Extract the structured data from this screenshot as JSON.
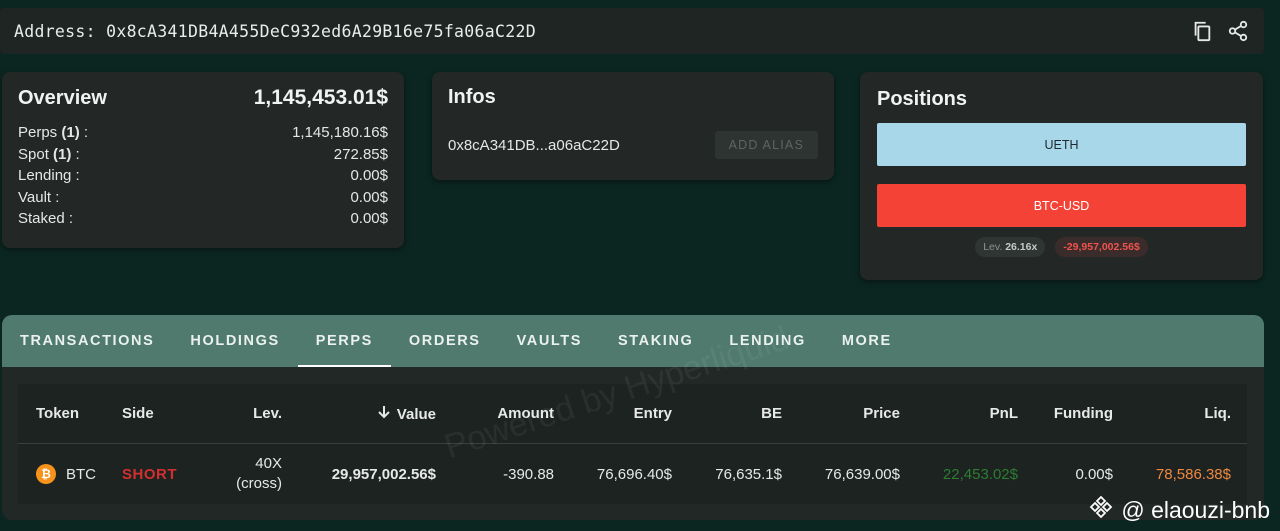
{
  "address_bar": {
    "label": "Address:",
    "address": "0x8cA341DB4A455DeC932ed6A29B16e75fa06aC22D",
    "icons": [
      "copy-icon",
      "share-icon"
    ]
  },
  "overview": {
    "title": "Overview",
    "total": "1,145,453.01$",
    "rows": [
      {
        "label": "Perps",
        "count": "(1)",
        "suffix": " :",
        "value": "1,145,180.16$"
      },
      {
        "label": "Spot",
        "count": "(1)",
        "suffix": " :",
        "value": "272.85$"
      },
      {
        "label": "Lending :",
        "count": "",
        "suffix": "",
        "value": "0.00$"
      },
      {
        "label": "Vault :",
        "count": "",
        "suffix": "",
        "value": "0.00$"
      },
      {
        "label": "Staked :",
        "count": "",
        "suffix": "",
        "value": "0.00$"
      }
    ]
  },
  "infos": {
    "title": "Infos",
    "short_address": "0x8cA341DB...a06aC22D",
    "alias_button": "ADD ALIAS"
  },
  "positions": {
    "title": "Positions",
    "items": [
      "UETH",
      "BTC-USD"
    ],
    "lev_label": "Lev.",
    "lev_value": "26.16x",
    "pnl": "-29,957,002.56$"
  },
  "tabs": [
    "TRANSACTIONS",
    "HOLDINGS",
    "PERPS",
    "ORDERS",
    "VAULTS",
    "STAKING",
    "LENDING",
    "MORE"
  ],
  "active_tab": "PERPS",
  "table": {
    "headers": {
      "token": "Token",
      "side": "Side",
      "lev": "Lev.",
      "value": "Value",
      "amount": "Amount",
      "entry": "Entry",
      "be": "BE",
      "price": "Price",
      "pnl": "PnL",
      "funding": "Funding",
      "liq": "Liq."
    },
    "rows": [
      {
        "token": "BTC",
        "side": "SHORT",
        "lev": "40X",
        "lev_mode": "(cross)",
        "value": "29,957,002.56$",
        "amount": "-390.88",
        "entry": "76,696.40$",
        "be": "76,635.1$",
        "price": "76,639.00$",
        "pnl": "22,453.02$",
        "funding": "0.00$",
        "liq": "78,586.38$"
      }
    ]
  },
  "watermark": "Powered by Hyperliquid",
  "credit": "@ elaouzi-bnb",
  "colors": {
    "tab_bar": "#4f7a6d",
    "ueth_btn": "#a9d7ea",
    "btc_btn": "#f44336",
    "short": "#d32f2f",
    "pnl_positive": "#2e7d32",
    "liq": "#f0883e"
  }
}
